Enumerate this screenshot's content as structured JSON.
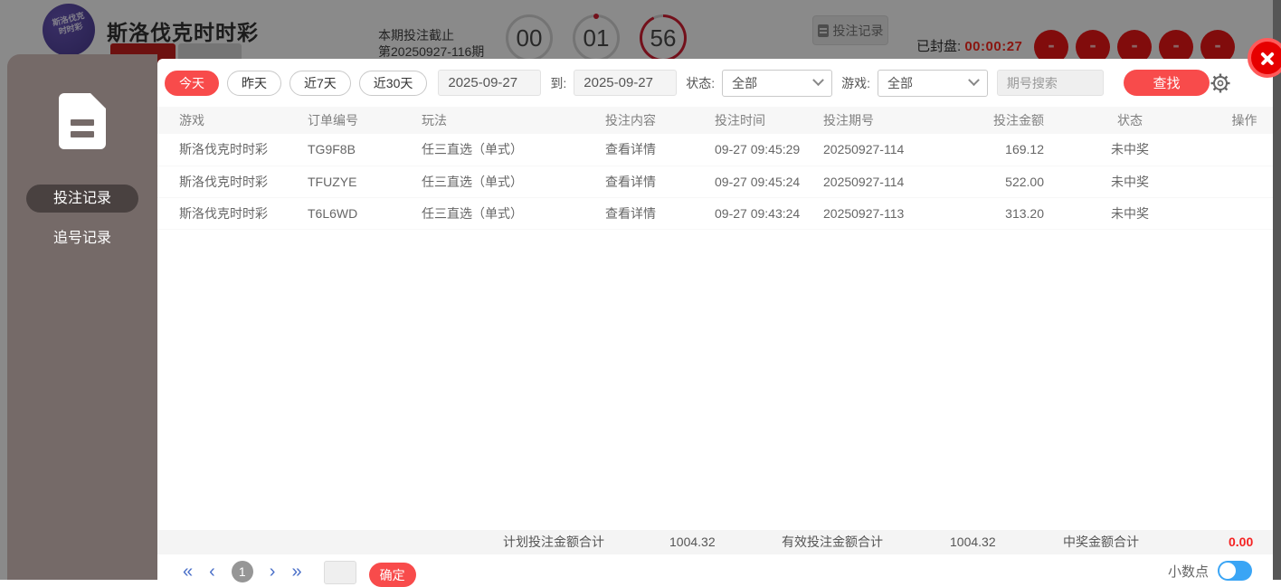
{
  "header": {
    "logo_line1": "斯洛伐克",
    "logo_line2": "时时彩",
    "title": "斯洛伐克时时彩",
    "deadline_label": "本期投注截止",
    "issue_label": "第20250927-116期",
    "countdown": {
      "hours": "00",
      "minutes": "01",
      "seconds": "56"
    },
    "record_button": "投注记录",
    "sealed_label": "已封盘:",
    "sealed_time": "00:00:27",
    "balls": [
      "-",
      "-",
      "-",
      "-",
      "-"
    ]
  },
  "sidebar": {
    "items": [
      {
        "label": "投注记录",
        "active": true
      },
      {
        "label": "追号记录",
        "active": false
      }
    ]
  },
  "modal": {
    "toolbar": {
      "filters": {
        "today": "今天",
        "yesterday": "昨天",
        "last7": "近7天",
        "last30": "近30天"
      },
      "date_from": "2025-09-27",
      "to_label": "到:",
      "date_to": "2025-09-27",
      "status_label": "状态:",
      "status_value": "全部",
      "game_label": "游戏:",
      "game_value": "全部",
      "issue_search_placeholder": "期号搜索",
      "search_button": "查找"
    },
    "table": {
      "columns": [
        "游戏",
        "订单编号",
        "玩法",
        "投注内容",
        "投注时间",
        "投注期号",
        "投注金额",
        "状态",
        "操作"
      ],
      "rows": [
        {
          "game": "斯洛伐克时时彩",
          "order": "TG9F8B",
          "play": "任三直选（单式）",
          "content_link": "查看详情",
          "time": "09-27 09:45:29",
          "issue": "20250927-114",
          "amount": "169.12",
          "status": "未中奖"
        },
        {
          "game": "斯洛伐克时时彩",
          "order": "TFUZYE",
          "play": "任三直选（单式）",
          "content_link": "查看详情",
          "time": "09-27 09:45:24",
          "issue": "20250927-114",
          "amount": "522.00",
          "status": "未中奖"
        },
        {
          "game": "斯洛伐克时时彩",
          "order": "T6L6WD",
          "play": "任三直选（单式）",
          "content_link": "查看详情",
          "time": "09-27 09:43:24",
          "issue": "20250927-113",
          "amount": "313.20",
          "status": "未中奖"
        }
      ]
    },
    "summary": {
      "planned_label": "计划投注金额合计",
      "planned_value": "1004.32",
      "valid_label": "有效投注金额合计",
      "valid_value": "1004.32",
      "win_label": "中奖金额合计",
      "win_value": "0.00"
    },
    "pagination": {
      "first": "«",
      "prev": "‹",
      "page": "1",
      "next": "›",
      "last": "»",
      "confirm_button": "确定",
      "decimal_label": "小数点"
    }
  },
  "colors": {
    "accent_red": "#f84b4b",
    "link_blue": "#5e7ce0",
    "toggle_blue": "#3aa5f5",
    "win_red": "#f42222"
  }
}
